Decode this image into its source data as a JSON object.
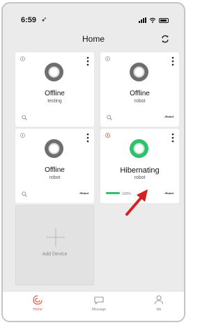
{
  "status_bar": {
    "time": "6:59",
    "location_glyph": "➶"
  },
  "header": {
    "title": "Home"
  },
  "devices": [
    {
      "status": "Offline",
      "name": "testing",
      "online": false
    },
    {
      "status": "Offline",
      "name": "robot",
      "online": false,
      "brand": "iRobot"
    },
    {
      "status": "Offline",
      "name": "robot",
      "online": false,
      "brand": "iRobot"
    },
    {
      "status": "Hibernating",
      "name": "robot",
      "online": true,
      "battery": "100%",
      "battery_level": 1.0,
      "brand": "iRobot"
    }
  ],
  "add_device": {
    "label": "Add Device"
  },
  "tabs": [
    {
      "label": "Home",
      "icon": "home-icon",
      "active": true
    },
    {
      "label": "Message",
      "icon": "message-icon",
      "active": false
    },
    {
      "label": "Me",
      "icon": "person-icon",
      "active": false
    }
  ],
  "colors": {
    "accent": "#e55a4a",
    "online": "#2fbf6d",
    "offline_robot": "#6e6e6e",
    "annotation_arrow": "#d42020"
  }
}
